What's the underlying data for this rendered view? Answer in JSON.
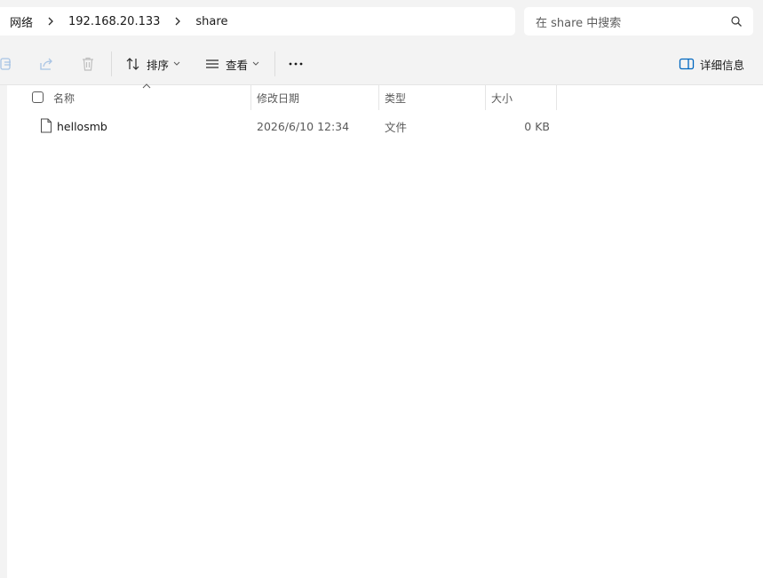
{
  "breadcrumb": {
    "items": [
      "网络",
      "192.168.20.133",
      "share"
    ]
  },
  "search": {
    "placeholder": "在 share 中搜索"
  },
  "toolbar": {
    "sort_label": "排序",
    "view_label": "查看",
    "details_label": "详细信息"
  },
  "columns": {
    "name": "名称",
    "modified": "修改日期",
    "type": "类型",
    "size": "大小"
  },
  "files": [
    {
      "name": "hellosmb",
      "modified": "2026/6/10 12:34",
      "type": "文件",
      "size": "0 KB"
    }
  ],
  "colors": {
    "chrome_bg": "#f3f3f3",
    "content_bg": "#ffffff",
    "accent": "#0067c0",
    "muted_text": "#5a5a5a"
  },
  "icons": [
    "copy-icon",
    "share-icon",
    "delete-icon",
    "sort-icon",
    "view-icon",
    "more-icon",
    "details-pane-icon",
    "search-icon",
    "chevron-right-icon",
    "file-icon"
  ]
}
